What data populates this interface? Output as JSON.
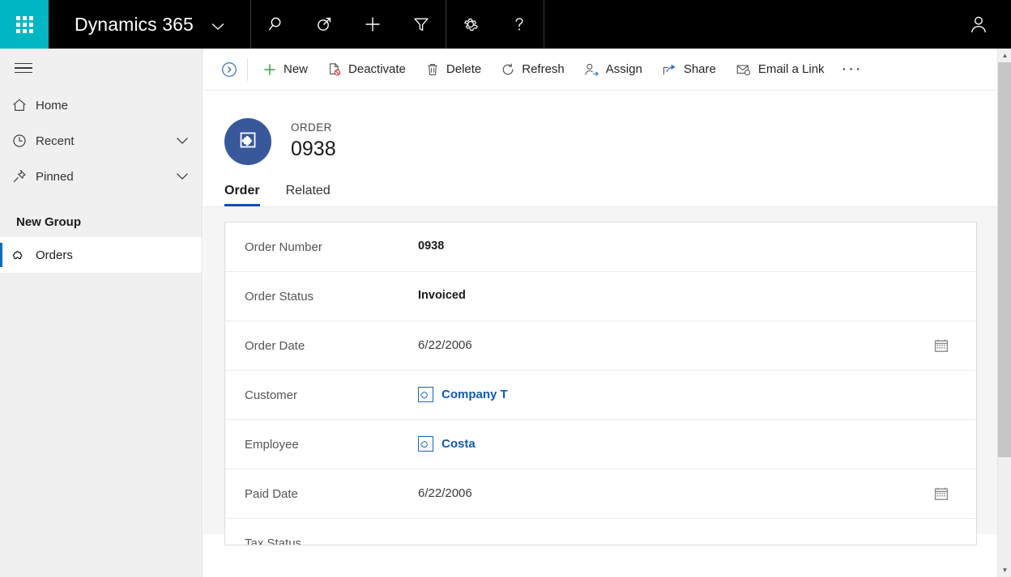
{
  "topbar": {
    "waffle_icon": "app-launcher-icon",
    "brand": "Dynamics 365",
    "brand_caret": "⌄",
    "icons": [
      {
        "name": "search-icon",
        "label": "Search"
      },
      {
        "name": "assistant-icon",
        "label": "Assistant"
      },
      {
        "name": "quick-create-icon",
        "label": "Quick Create"
      },
      {
        "name": "filter-icon",
        "label": "Filter"
      },
      {
        "name": "settings-gear-icon",
        "label": "Settings"
      },
      {
        "name": "help-question-icon",
        "label": "Help"
      },
      {
        "name": "user-avatar-icon",
        "label": "User"
      }
    ]
  },
  "sidebar": {
    "hamburger_label": "Expand navigation",
    "items": [
      {
        "label": "Home",
        "icon": "home-icon",
        "chevron": false,
        "selected": false
      },
      {
        "label": "Recent",
        "icon": "clock-icon",
        "chevron": true,
        "selected": false
      },
      {
        "label": "Pinned",
        "icon": "pin-icon",
        "chevron": true,
        "selected": false
      }
    ],
    "group_title": "New Group",
    "group_items": [
      {
        "label": "Orders",
        "icon": "entity-puzzle-icon",
        "selected": true
      }
    ]
  },
  "commandbar": {
    "expand_icon": "chevron-right-circle-icon",
    "buttons": [
      {
        "label": "New",
        "icon": "plus-icon"
      },
      {
        "label": "Deactivate",
        "icon": "deactivate-icon"
      },
      {
        "label": "Delete",
        "icon": "trash-icon"
      },
      {
        "label": "Refresh",
        "icon": "refresh-icon"
      },
      {
        "label": "Assign",
        "icon": "assign-person-icon"
      },
      {
        "label": "Share",
        "icon": "share-icon"
      },
      {
        "label": "Email a Link",
        "icon": "email-link-icon"
      }
    ],
    "overflow_label": "···"
  },
  "record": {
    "entity_label": "ORDER",
    "title": "0938",
    "icon": "entity-puzzle-icon"
  },
  "tabs": [
    {
      "label": "Order",
      "active": true
    },
    {
      "label": "Related",
      "active": false
    }
  ],
  "form": {
    "fields": [
      {
        "label": "Order Number",
        "value": "0938",
        "type": "readonly"
      },
      {
        "label": "Order Status",
        "value": "Invoiced",
        "type": "readonly"
      },
      {
        "label": "Order Date",
        "value": "6/22/2006",
        "type": "date",
        "icon": "calendar-icon"
      },
      {
        "label": "Customer",
        "value": "Company T",
        "type": "lookup",
        "icon": "entity-puzzle-icon"
      },
      {
        "label": "Employee",
        "value": "Costa",
        "type": "lookup",
        "icon": "entity-puzzle-icon"
      },
      {
        "label": "Paid Date",
        "value": "6/22/2006",
        "type": "date",
        "icon": "calendar-icon"
      },
      {
        "label": "Tax Status",
        "value": "",
        "type": "clipped"
      }
    ]
  },
  "scrollbar": {
    "up_arrow": "▲",
    "down_arrow": "▼"
  },
  "colors": {
    "accent_teal": "#00b7c3",
    "topbar_black": "#000000",
    "tab_underline_blue": "#0f4bb3",
    "link_blue": "#0f5cad",
    "record_circle_blue": "#37589b",
    "sidebar_bg": "#f0f0f0",
    "form_bg": "#f5f5f5",
    "selected_marker_blue": "#0f6cbd",
    "new_plus_green": "#3aa14a",
    "deactivate_red": "#d13438"
  }
}
